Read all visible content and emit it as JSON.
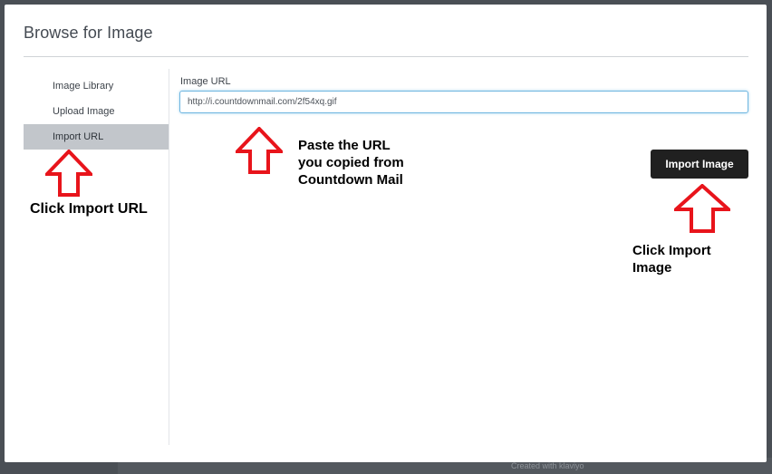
{
  "dialog": {
    "title": "Browse for Image"
  },
  "sidebar": {
    "items": [
      {
        "label": "Image Library"
      },
      {
        "label": "Upload Image"
      },
      {
        "label": "Import URL"
      }
    ]
  },
  "form": {
    "url_label": "Image URL",
    "url_value": "http://i.countdownmail.com/2f54xq.gif",
    "import_button": "Import Image"
  },
  "annotations": {
    "left": "Click Import URL",
    "middle": [
      "Paste the URL",
      "you copied from",
      "Countdown Mail"
    ],
    "right": [
      "Click Import",
      "Image"
    ],
    "arrow_color": "#e8141b"
  },
  "background": {
    "footer_text": "Created with klaviyo"
  }
}
